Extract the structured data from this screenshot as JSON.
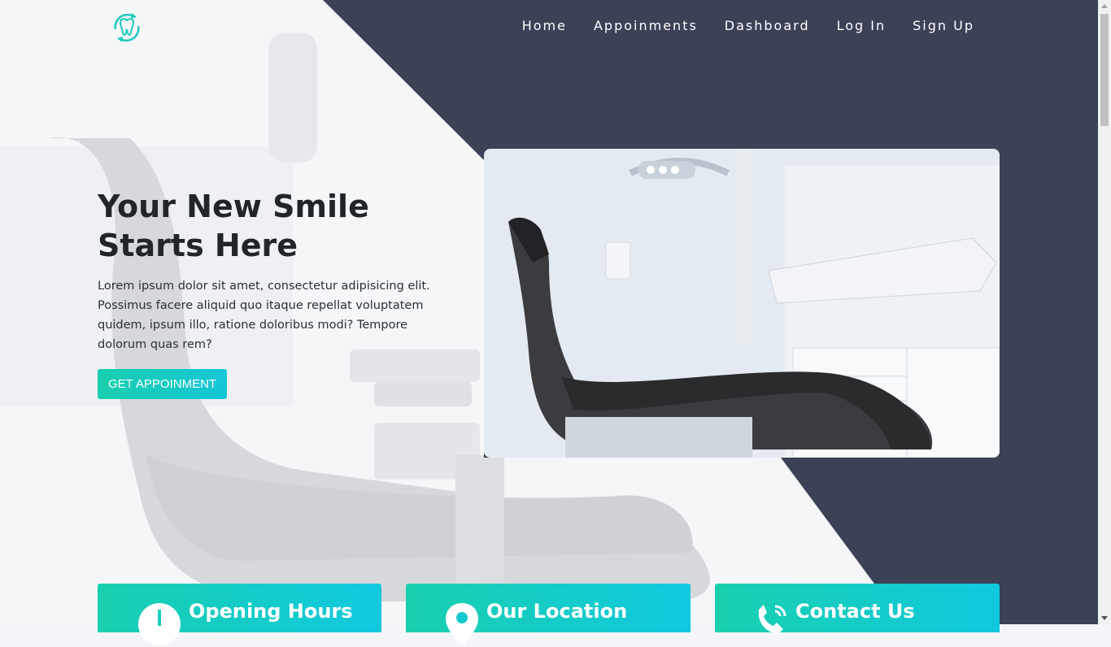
{
  "nav": {
    "logo": "tooth-logo-icon",
    "links": [
      "Home",
      "Appoinments",
      "Dashboard",
      "Log In",
      "Sign Up"
    ]
  },
  "hero": {
    "title_line1": "Your New Smile",
    "title_line2": "Starts Here",
    "body": "Lorem ipsum dolor sit amet, consectetur adipisicing elit. Possimus facere aliquid quo itaque repellat voluptatem quidem, ipsum illo, ratione doloribus modi? Tempore dolorum quas rem?",
    "cta_label": "GET APPOINMENT"
  },
  "cards": [
    {
      "label": "Opening Hours",
      "icon": "clock-icon"
    },
    {
      "label": "Our Location",
      "icon": "location-pin-icon"
    },
    {
      "label": "Contact Us",
      "icon": "phone-icon"
    }
  ],
  "colors": {
    "dark_panel": "#3b4256",
    "accent_start": "#19cfae",
    "accent_end": "#15c6d7",
    "logo": "#1cc9bf"
  }
}
